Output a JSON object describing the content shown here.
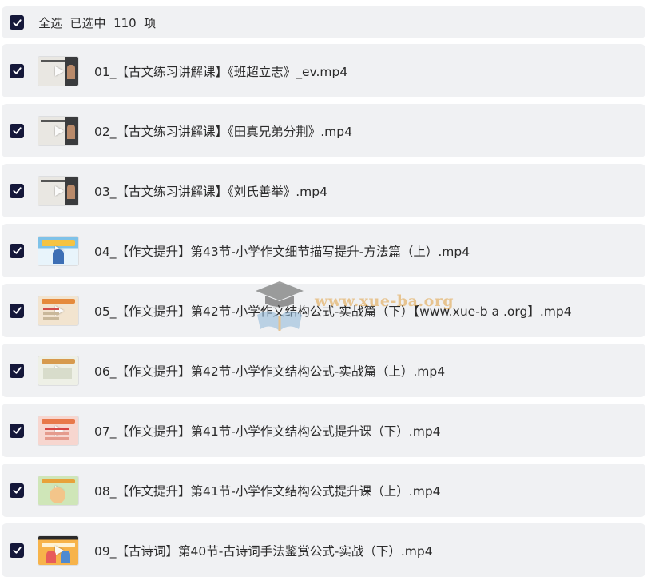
{
  "header": {
    "checked": true,
    "label": "全选  已选中  110  项"
  },
  "files": [
    {
      "name": "01_【古文练习讲解课】《班超立志》_ev.mp4",
      "checked": true,
      "thumb": "t-dark"
    },
    {
      "name": "02_【古文练习讲解课】《田真兄弟分荆》.mp4",
      "checked": true,
      "thumb": "t-dark"
    },
    {
      "name": "03_【古文练习讲解课】《刘氏善举》.mp4",
      "checked": true,
      "thumb": "t-dark"
    },
    {
      "name": "04_【作文提升】第43节-小学作文细节描写提升-方法篇（上）.mp4",
      "checked": true,
      "thumb": "t-blue"
    },
    {
      "name": "05_【作文提升】第42节-小学作文结构公式-实战篇（下）【www.xue-b a .org】.mp4",
      "checked": true,
      "thumb": "t-tan"
    },
    {
      "name": "06_【作文提升】第42节-小学作文结构公式-实战篇（上）.mp4",
      "checked": true,
      "thumb": "t-tan2"
    },
    {
      "name": "07_【作文提升】第41节-小学作文结构公式提升课（下）.mp4",
      "checked": true,
      "thumb": "t-pink"
    },
    {
      "name": "08_【作文提升】第41节-小学作文结构公式提升课（上）.mp4",
      "checked": true,
      "thumb": "t-green"
    },
    {
      "name": "09_【古诗词】第40节-古诗词手法鉴赏公式-实战（下）.mp4",
      "checked": true,
      "thumb": "t-orange"
    }
  ],
  "watermark": {
    "text": "www.xue-ba.org",
    "icon": "graduation-cap-book-icon"
  },
  "colors": {
    "checkbox": "#15183a",
    "row_bg": "#f0f1f3",
    "text": "#2b2b2b",
    "watermark": "#e0a040"
  }
}
